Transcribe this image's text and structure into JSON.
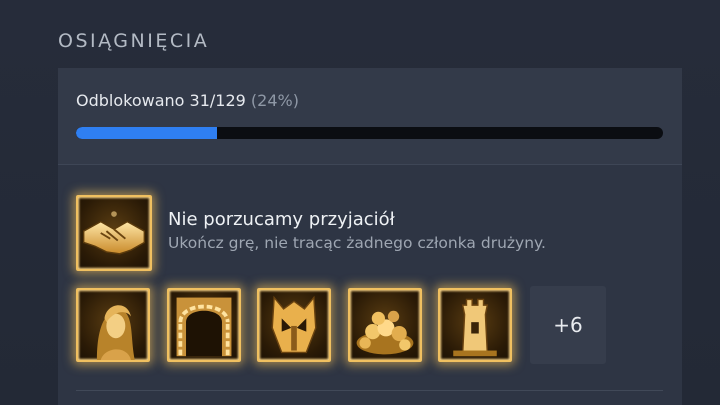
{
  "section": {
    "title": "OSIĄGNIĘCIA"
  },
  "progress": {
    "label": "Odblokowano 31/129",
    "percent_text": "(24%)",
    "unlocked": 31,
    "total": 129,
    "fraction": 0.24,
    "bar_color": "#2f7ff2"
  },
  "featured": {
    "title": "Nie porzucamy przyjaciół",
    "description": "Ukończ grę, nie tracąc żadnego członka drużyny.",
    "icon": "handshake-icon"
  },
  "achievements": [
    {
      "icon": "woman-portrait-icon"
    },
    {
      "icon": "stone-archway-icon"
    },
    {
      "icon": "golden-helmet-icon"
    },
    {
      "icon": "treasure-pile-icon"
    },
    {
      "icon": "tower-icon"
    }
  ],
  "more": {
    "label": "+6"
  },
  "colors": {
    "gold_glow": "#f0c060",
    "panel": "#2e3544",
    "background": "#262c3a"
  }
}
